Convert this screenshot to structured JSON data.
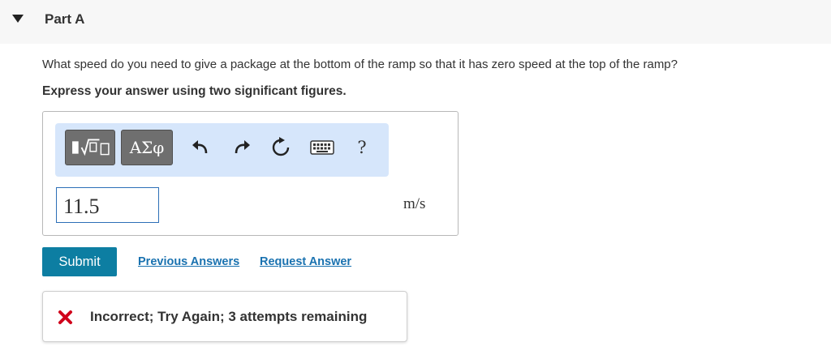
{
  "part": {
    "title": "Part A",
    "expanded": true
  },
  "question": {
    "text": "What speed do you need to give a package at the bottom of the ramp so that it has zero speed at the top of the ramp?",
    "instruction": "Express your answer using two significant figures."
  },
  "toolbar": {
    "templates_icon": "templates-radical-icon",
    "symbols_label": "ΑΣφ",
    "undo_icon": "undo-icon",
    "redo_icon": "redo-icon",
    "reset_icon": "reset-icon",
    "keyboard_icon": "keyboard-icon",
    "help_label": "?"
  },
  "answer": {
    "value": "11.5",
    "unit": "m/s"
  },
  "actions": {
    "submit_label": "Submit",
    "previous_answers_label": "Previous Answers",
    "request_answer_label": "Request Answer"
  },
  "feedback": {
    "status": "incorrect",
    "message": "Incorrect; Try Again; 3 attempts remaining",
    "icon": "cross-icon",
    "icon_color": "#d0021b"
  },
  "colors": {
    "submit": "#0d7ea2",
    "link": "#1a72b0",
    "toolbar_bg": "#d6e6fb",
    "input_border": "#2d6fb7"
  }
}
